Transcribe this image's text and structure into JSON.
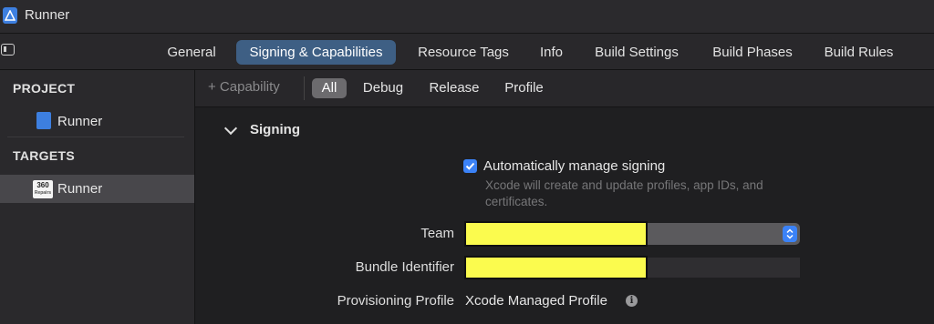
{
  "window": {
    "title": "Runner"
  },
  "tabs": [
    {
      "label": "General"
    },
    {
      "label": "Signing & Capabilities",
      "active": true
    },
    {
      "label": "Resource Tags"
    },
    {
      "label": "Info"
    },
    {
      "label": "Build Settings"
    },
    {
      "label": "Build Phases"
    },
    {
      "label": "Build Rules"
    }
  ],
  "sidebar": {
    "project_header": "PROJECT",
    "project_item": "Runner",
    "targets_header": "TARGETS",
    "target_item": "Runner",
    "target_icon_text": "360",
    "target_icon_subtext": "Repairs"
  },
  "toolbar": {
    "capability_label": "+ Capability",
    "filters": [
      "All",
      "Debug",
      "Release",
      "Profile"
    ],
    "active_filter": "All"
  },
  "signing": {
    "section_title": "Signing",
    "auto_manage_label": "Automatically manage signing",
    "auto_manage_checked": true,
    "auto_manage_help": "Xcode will create and update profiles, app IDs, and certificates.",
    "team_label": "Team",
    "team_value": "",
    "bundle_label": "Bundle Identifier",
    "bundle_value": "",
    "provisioning_label": "Provisioning Profile",
    "provisioning_value": "Xcode Managed Profile"
  },
  "colors": {
    "accent": "#3b82f7",
    "selected_tab": "#3e5f84",
    "redaction": "#fbfb4e"
  }
}
